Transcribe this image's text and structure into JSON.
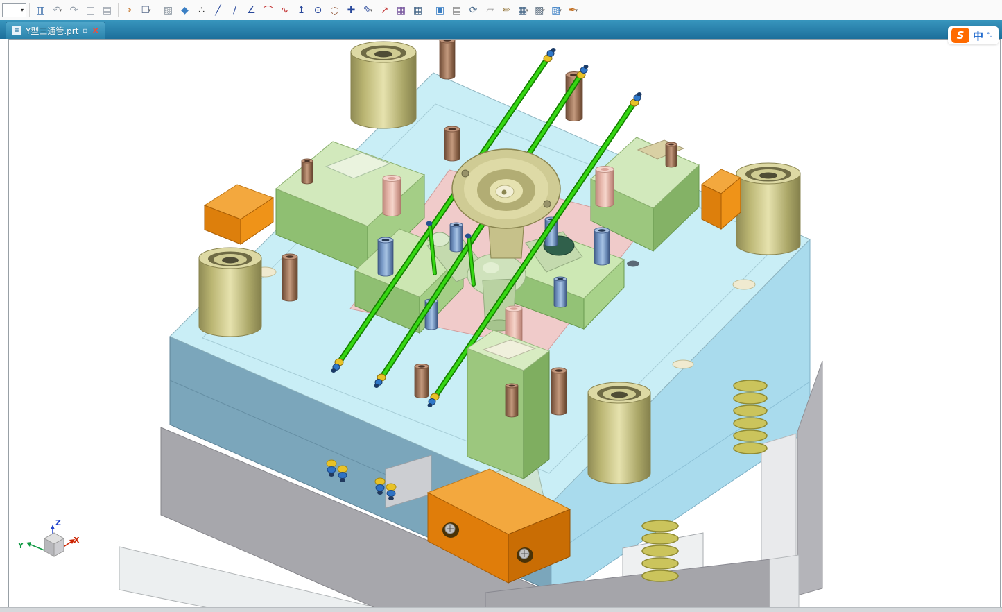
{
  "toolbar": {
    "icons": [
      {
        "name": "selection-filter-combo",
        "combo": true,
        "glyph": "▾"
      },
      {
        "sep": true
      },
      {
        "name": "paste-sketch-icon",
        "glyph": "▥",
        "color": "#4a78b0"
      },
      {
        "name": "undo-icon",
        "glyph": "↶",
        "color": "#8f9aa6",
        "dd": true
      },
      {
        "name": "redo-icon",
        "glyph": "↷",
        "color": "#8f9aa6"
      },
      {
        "name": "copy-icon",
        "glyph": "□",
        "color": "#9aa2ac"
      },
      {
        "name": "paste-icon",
        "glyph": "▤",
        "color": "#9aa2ac"
      },
      {
        "sep": true
      },
      {
        "name": "pick-tool-icon",
        "glyph": "⌖",
        "color": "#c06a1a"
      },
      {
        "name": "box-select-icon",
        "glyph": "☐",
        "color": "#5a6c8c",
        "dd": true
      },
      {
        "sep": true
      },
      {
        "name": "wireframe-cube-icon",
        "glyph": "▧",
        "color": "#8a95a0"
      },
      {
        "name": "shaded-cube-icon",
        "glyph": "◆",
        "color": "#3b7fc4"
      },
      {
        "name": "points-icon",
        "glyph": "∴",
        "color": "#3a3a3a"
      },
      {
        "name": "line-icon",
        "glyph": "╱",
        "color": "#27479a"
      },
      {
        "name": "infinite-line-icon",
        "glyph": "∕",
        "color": "#27479a"
      },
      {
        "name": "polyline-icon",
        "glyph": "∠",
        "color": "#27479a"
      },
      {
        "name": "arc-icon",
        "glyph": "⌒",
        "color": "#c23030"
      },
      {
        "name": "spline-icon",
        "glyph": "∿",
        "color": "#c23030"
      },
      {
        "name": "axis-point-icon",
        "glyph": "↥",
        "color": "#27479a"
      },
      {
        "name": "circle-icon",
        "glyph": "⊙",
        "color": "#27479a"
      },
      {
        "name": "construction-circle-icon",
        "glyph": "◌",
        "color": "#8a4a2a"
      },
      {
        "name": "center-cross-icon",
        "glyph": "✚",
        "color": "#27479a"
      },
      {
        "name": "sketch-pencil-icon",
        "glyph": "✎",
        "color": "#27479a",
        "dd": true
      },
      {
        "name": "extrude-arrow-icon",
        "glyph": "↗",
        "color": "#c23030"
      },
      {
        "name": "surface-mesh-icon",
        "glyph": "▦",
        "color": "#7a5aa0"
      },
      {
        "name": "grid-table-icon",
        "glyph": "▦",
        "color": "#4a6a8a"
      },
      {
        "sep": true
      },
      {
        "name": "view-frame-icon",
        "glyph": "▣",
        "color": "#3b7fc4"
      },
      {
        "name": "image-view-icon",
        "glyph": "▤",
        "color": "#8a8a8a"
      },
      {
        "name": "rotate-view-icon",
        "glyph": "⟳",
        "color": "#4a6a8a"
      },
      {
        "name": "plane-view-icon",
        "glyph": "▱",
        "color": "#8a8a8a"
      },
      {
        "name": "edit-pencil-icon",
        "glyph": "✏",
        "color": "#8a6a2a"
      },
      {
        "name": "grid-options-icon",
        "glyph": "▦",
        "color": "#4a6a8a",
        "dd": true
      },
      {
        "name": "layers-icon",
        "glyph": "▩",
        "color": "#6a7a8a",
        "dd": true
      },
      {
        "name": "solid-cube-options-icon",
        "glyph": "▨",
        "color": "#3b7fc4",
        "dd": true
      },
      {
        "name": "annotation-pen-icon",
        "glyph": "✒",
        "color": "#c06a1a",
        "dd": true
      }
    ]
  },
  "tabbar": {
    "doc_glyph": "≡",
    "title": "Y型三通管.prt",
    "float_glyph": "▫",
    "close_glyph": "×"
  },
  "ime": {
    "logo": "S",
    "mode": "中",
    "extra": "°,"
  },
  "triad": {
    "x": "X",
    "y": "Y",
    "z": "Z",
    "x_color": "#cc2200",
    "y_color": "#119944",
    "z_color": "#2244cc"
  },
  "palette": {
    "plate_top": "#c9eef6",
    "plate_left": "#7ba6bb",
    "plate_right": "#a9dbed",
    "base_gray": "#a7a7ac",
    "core_pink": "#f0cbca",
    "slider_green": "#9cc77e",
    "slider_green_top": "#d2e9bc",
    "bushing_khaki": "#cfcb94",
    "screw_brown": "#a87c5f",
    "pin_salmon": "#e8b4aa",
    "screw_blue": "#7b9cc9",
    "angle_pin_green": "#35d612",
    "fitting_gold": "#e8c227",
    "fitting_blue": "#2f77c8",
    "wedge_orange": "#f3a83e",
    "spring_olive": "#cbc45c",
    "tabbar_teal": "#2f8cb5",
    "ime_orange": "#ff6a00"
  }
}
